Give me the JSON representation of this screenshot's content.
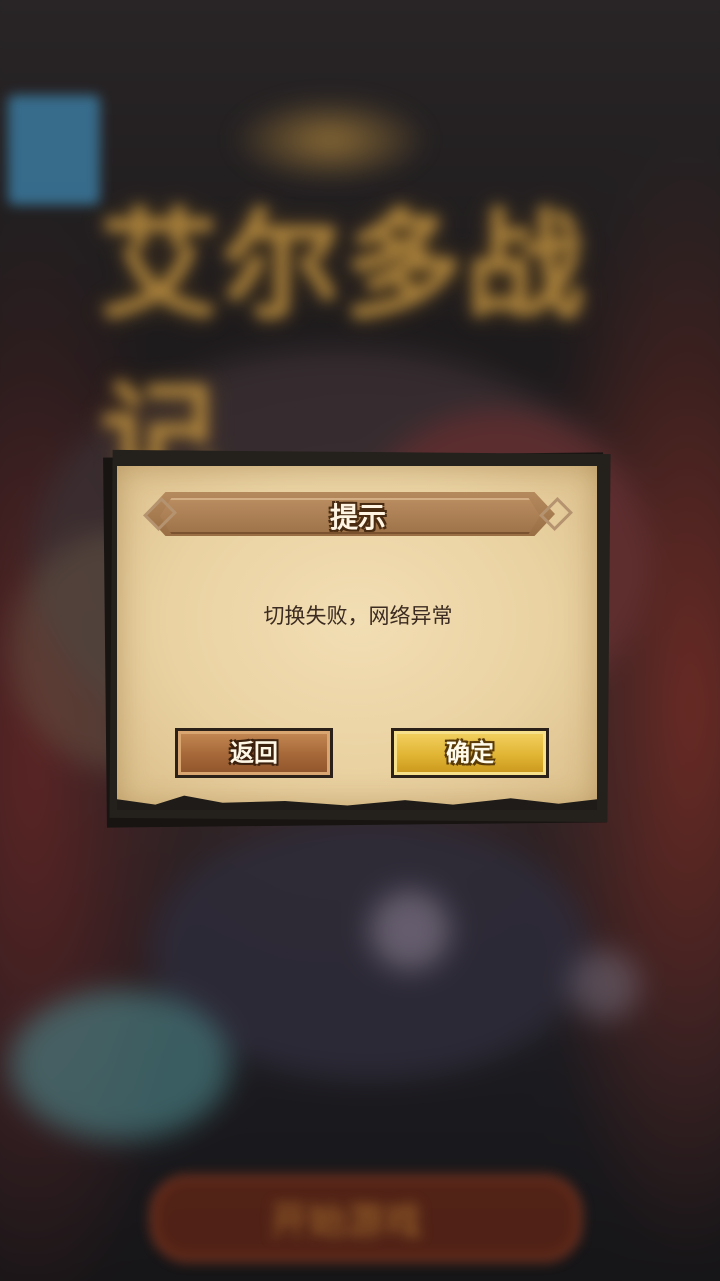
{
  "background": {
    "logo_text": "艾尔多战记",
    "start_button_text": "开始游戏"
  },
  "dialog": {
    "title": "提示",
    "message": "切换失败，网络异常",
    "back_button": "返回",
    "confirm_button": "确定"
  },
  "colors": {
    "paper": "#ead2a2",
    "back_button": "#a86a3a",
    "confirm_button": "#e1b534",
    "frame": "#171412"
  }
}
